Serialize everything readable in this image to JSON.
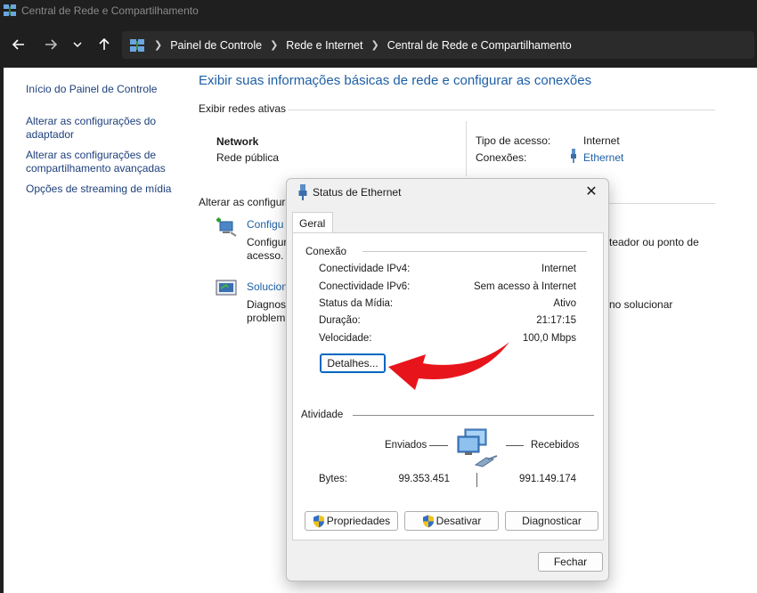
{
  "window": {
    "title": "Central de Rede e Compartilhamento"
  },
  "breadcrumb": {
    "items": [
      "Painel de Controle",
      "Rede e Internet",
      "Central de Rede e Compartilhamento"
    ]
  },
  "sidebar": {
    "items": [
      {
        "label": "Início do Painel de Controle"
      },
      {
        "label": "Alterar as configurações do adaptador"
      },
      {
        "label": "Alterar as configurações de compartilhamento avançadas"
      },
      {
        "label": "Opções de streaming de mídia"
      }
    ],
    "lines": {
      "item1a": "Alterar as configurações do",
      "item1b": "adaptador",
      "item2a": "Alterar as configurações de",
      "item2b": "compartilhamento avançadas"
    }
  },
  "main": {
    "title": "Exibir suas informações básicas de rede e configurar as conexões",
    "active_networks_label": "Exibir redes ativas",
    "network_name": "Network",
    "network_type": "Rede pública",
    "access_type_label": "Tipo de acesso:",
    "access_type_value": "Internet",
    "connections_label": "Conexões:",
    "connections_value": "Ethernet",
    "change_label_partial": "Alterar as configura",
    "task1_link_partial": "Configu",
    "task1_desc1_partial": "Configur",
    "task1_desc2_partial": "acesso.",
    "task1_desc_right": "teador ou ponto de",
    "task2_link_partial": "Solucion",
    "task2_desc1_partial": "Diagnos",
    "task2_desc2_partial": "problem",
    "task2_desc_right": "no solucionar"
  },
  "dialog": {
    "title": "Status de Ethernet",
    "tab": "Geral",
    "connection_label": "Conexão",
    "rows": [
      {
        "label": "Conectividade IPv4:",
        "value": "Internet"
      },
      {
        "label": "Conectividade IPv6:",
        "value": "Sem acesso à Internet"
      },
      {
        "label": "Status da Mídia:",
        "value": "Ativo"
      },
      {
        "label": "Duração:",
        "value": "21:17:15"
      },
      {
        "label": "Velocidade:",
        "value": "100,0 Mbps"
      }
    ],
    "details_button": "Detalhes...",
    "activity_label": "Atividade",
    "sent_label": "Enviados",
    "received_label": "Recebidos",
    "bytes_label": "Bytes:",
    "bytes_sent": "99.353.451",
    "bytes_received": "991.149.174",
    "properties_button": "Propriedades",
    "disable_button": "Desativar",
    "diagnose_button": "Diagnosticar",
    "close_button": "Fechar"
  },
  "colors": {
    "link": "#1e5fa5",
    "title_bar": "#1f1f1f",
    "arrow": "#e8141b"
  }
}
